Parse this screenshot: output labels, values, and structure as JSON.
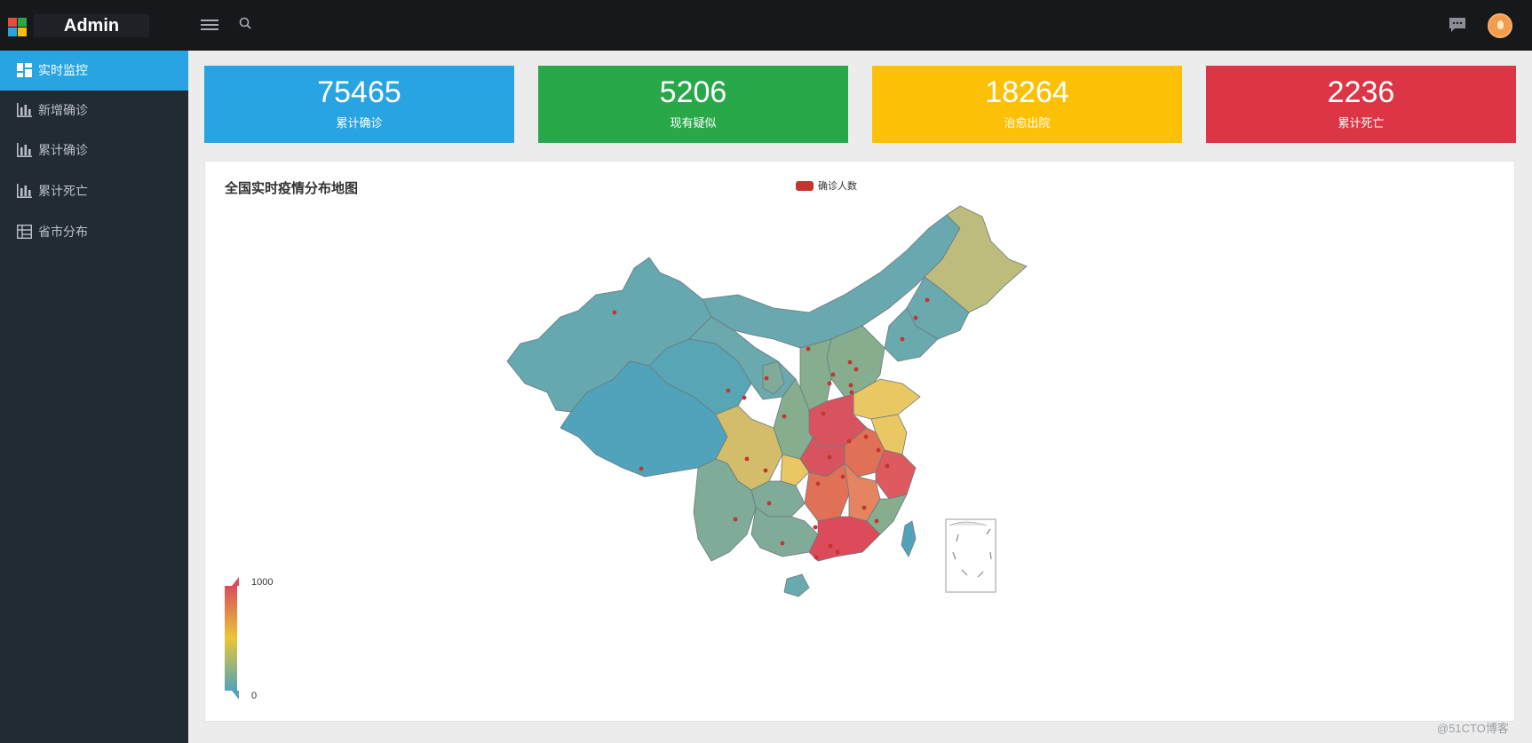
{
  "app": {
    "title": "Admin"
  },
  "sidebar": {
    "items": [
      {
        "label": "实时监控",
        "icon": "dashboard-icon",
        "active": true
      },
      {
        "label": "新增确诊",
        "icon": "bar-chart-icon",
        "active": false
      },
      {
        "label": "累计确诊",
        "icon": "bar-chart-icon",
        "active": false
      },
      {
        "label": "累计死亡",
        "icon": "bar-chart-icon",
        "active": false
      },
      {
        "label": "省市分布",
        "icon": "grid-table-icon",
        "active": false
      }
    ]
  },
  "header": {
    "icons": [
      "menu-icon",
      "search-icon",
      "message-icon",
      "avatar"
    ]
  },
  "stats": [
    {
      "value": "75465",
      "label": "累计确诊",
      "color": "#29a4e2"
    },
    {
      "value": "5206",
      "label": "现有疑似",
      "color": "#29a84a"
    },
    {
      "value": "18264",
      "label": "治愈出院",
      "color": "#fcc107"
    },
    {
      "value": "2236",
      "label": "累计死亡",
      "color": "#dc3545"
    }
  ],
  "map": {
    "title": "全国实时疫情分布地图",
    "legend": "确诊人数",
    "visual_map": {
      "max": "1000",
      "min": "0",
      "colors": [
        "#d94e5d",
        "#eac736",
        "#50a3ba"
      ]
    }
  },
  "watermark": "@51CTO博客"
}
